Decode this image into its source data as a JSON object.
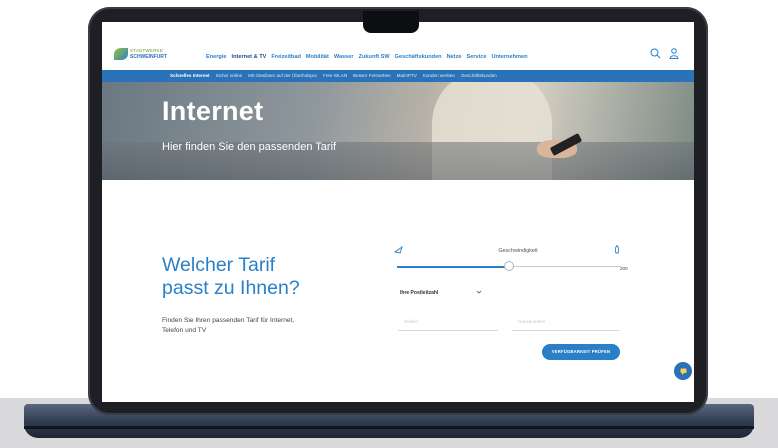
{
  "brand": {
    "line1": "STADTWERKE",
    "line2": "SCHWEINFURT"
  },
  "nav": {
    "items": [
      "Energie",
      "Internet & TV",
      "Freizeitbad",
      "Mobilität",
      "Wasser",
      "Zukunft SW",
      "Geschäftskunden",
      "Netze",
      "Service",
      "Unternehmen"
    ]
  },
  "subnav": {
    "items": [
      "Schnelles Internet",
      "Sicher online",
      "Mit Glasfaser auf der Überholspur",
      "Free WLAN",
      "Besser Fernsehen",
      "MainIPTV",
      "Kunden werben",
      "Geschäftskunden"
    ]
  },
  "hero": {
    "title": "Internet",
    "subtitle": "Hier finden Sie den passenden Tarif"
  },
  "finder": {
    "heading_line1": "Welcher Tarif",
    "heading_line2": "passt zu Ihnen?",
    "description": "Finden Sie Ihren passenden Tarif für Internet, Telefon und TV",
    "speed_label": "Geschwindigkeit",
    "speed_max": "200",
    "speed_level": 0.5,
    "postcode_select": "Ihre Postleitzahl",
    "street_placeholder": "Straße",
    "number_placeholder": "Hausnummer",
    "cta_label": "VERFÜGBARKEIT PRÜFEN"
  },
  "colors": {
    "accent": "#2a7fc7",
    "subnav_bg": "#2b73b9",
    "chat_bg": "#2a72b6"
  },
  "icons": [
    "search-icon",
    "user-icon",
    "snail-icon",
    "rocket-icon",
    "chevron-down-icon",
    "chat-icon"
  ]
}
